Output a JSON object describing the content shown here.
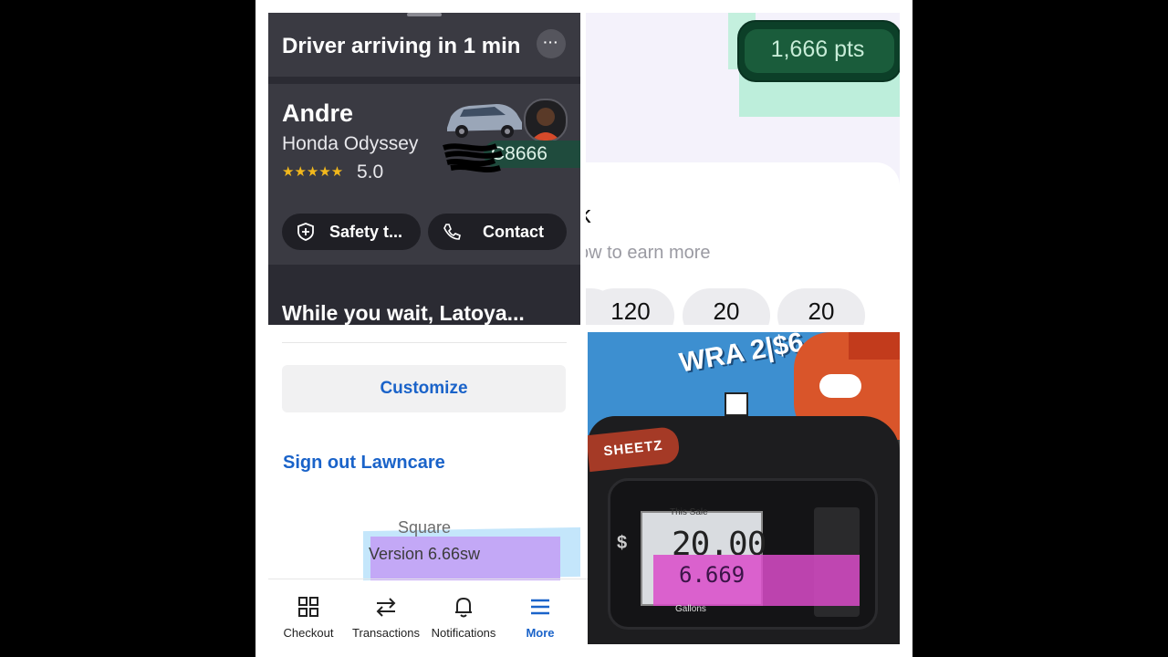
{
  "ride": {
    "status": "Driver arriving in 1 min",
    "more_label": "···",
    "driver_name": "Andre",
    "car_model": "Honda Odyssey",
    "plate_partial": "C8666",
    "stars": "★★★★★",
    "rating": "5.0",
    "safety_label": "Safety t...",
    "contact_label": "Contact",
    "wait_heading": "While you wait, Latoya..."
  },
  "points": {
    "balance": "1,666 pts",
    "heading_partial": "k",
    "subtitle_partial": "ow to earn more",
    "chips": [
      "120",
      "20",
      "20"
    ],
    "chip_partial": "2"
  },
  "square": {
    "customize_label": "Customize",
    "signout_label": "Sign out Lawncare",
    "app_name": "Square",
    "version": "Version 6.66sw",
    "tabs": [
      {
        "label": "Checkout",
        "icon": "grid-icon"
      },
      {
        "label": "Transactions",
        "icon": "swap-arrows-icon"
      },
      {
        "label": "Notifications",
        "icon": "bell-icon"
      },
      {
        "label": "More",
        "icon": "menu-icon"
      }
    ],
    "active_tab": "More",
    "accent_color": "#1a63c9"
  },
  "pump": {
    "sign_text": "WRA 2|$6",
    "brand": "SHEETZ",
    "sale_label": "This Sale",
    "sale_value": "20.00",
    "gallons_value": "6.669",
    "gallons_label": "Gallons",
    "currency_symbol": "$"
  }
}
